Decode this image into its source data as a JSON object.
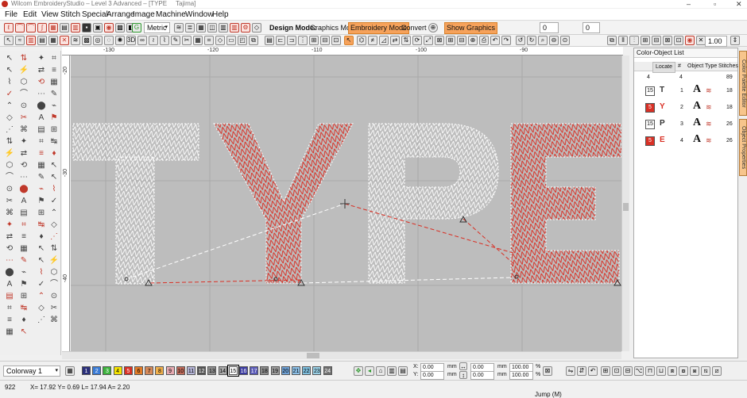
{
  "titlebar": {
    "title": "Wilcom EmbroideryStudio – Level 3 Advanced – [TYPE",
    "machine": "Tajima]"
  },
  "menu": [
    "File",
    "Edit",
    "View",
    "Stitch",
    "Special",
    "Arrange",
    "Image",
    "Machine",
    "Window",
    "Help"
  ],
  "toolbar1": {
    "units": "Metric",
    "design_mode_label": "Design Mode:",
    "graphics_mode": "Graphics Mode",
    "embroidery_mode": "Embroidery Mode",
    "convert": "Convert",
    "show_graphics": "Show Graphics"
  },
  "toolbar2": {
    "field_a": "0",
    "field_b": "0",
    "zoom": "1.00"
  },
  "rulers": {
    "top": [
      "-130",
      "-120",
      "-110",
      "-100",
      "-90"
    ],
    "left": [
      "-20",
      "-30",
      "-40"
    ]
  },
  "design": {
    "letters": [
      {
        "char": "T",
        "color": "white"
      },
      {
        "char": "Y",
        "color": "red"
      },
      {
        "char": "P",
        "color": "white"
      },
      {
        "char": "E",
        "color": "red"
      }
    ]
  },
  "panel": {
    "title": "Color-Object List",
    "locate": "Locate",
    "columns": [
      "#",
      "Object Type",
      "Stitches"
    ],
    "header_row": {
      "a": "4",
      "b": "4",
      "c": "89"
    },
    "rows": [
      {
        "color_num": "15",
        "letter": "T",
        "index": "1",
        "stitches": "18",
        "swatch": "#ffffff",
        "letter_color": "#333333"
      },
      {
        "color_num": "5",
        "letter": "Y",
        "index": "2",
        "stitches": "18",
        "swatch": "#d93025",
        "letter_color": "#d93025"
      },
      {
        "color_num": "15",
        "letter": "P",
        "index": "3",
        "stitches": "26",
        "swatch": "#ffffff",
        "letter_color": "#333333"
      },
      {
        "color_num": "5",
        "letter": "E",
        "index": "4",
        "stitches": "26",
        "swatch": "#d93025",
        "letter_color": "#d93025"
      }
    ],
    "tabs": [
      "Color Palette Editor",
      "Object Properties"
    ]
  },
  "colorbar": {
    "colorway": "Colorway 1",
    "palette": [
      {
        "n": "1",
        "c": "#2a2f7a"
      },
      {
        "n": "2",
        "c": "#3a7bd5"
      },
      {
        "n": "3",
        "c": "#3db23d"
      },
      {
        "n": "4",
        "c": "#f5e300"
      },
      {
        "n": "5",
        "c": "#d93025"
      },
      {
        "n": "6",
        "c": "#e27b27"
      },
      {
        "n": "7",
        "c": "#d68a5a"
      },
      {
        "n": "8",
        "c": "#f1b04c"
      },
      {
        "n": "9",
        "c": "#e7aab1"
      },
      {
        "n": "10",
        "c": "#c16b5a"
      },
      {
        "n": "11",
        "c": "#b6b6d8"
      },
      {
        "n": "12",
        "c": "#545454"
      },
      {
        "n": "13",
        "c": "#8f8f8f"
      },
      {
        "n": "14",
        "c": "#a8a8a8"
      },
      {
        "n": "15",
        "c": "#ffffff"
      },
      {
        "n": "16",
        "c": "#3a3aa0"
      },
      {
        "n": "17",
        "c": "#5a5ab8"
      },
      {
        "n": "18",
        "c": "#8c8c8c"
      },
      {
        "n": "19",
        "c": "#9c9c9c"
      },
      {
        "n": "20",
        "c": "#6ea1d6"
      },
      {
        "n": "21",
        "c": "#8cc0e8"
      },
      {
        "n": "22",
        "c": "#7fc0e0"
      },
      {
        "n": "23",
        "c": "#9ad0e6"
      },
      {
        "n": "24",
        "c": "#707070"
      }
    ],
    "x_label": "X:",
    "y_label": "Y:",
    "x_val": "0.00",
    "y_val": "0.00",
    "w_val": "0.00",
    "h_val": "0.00",
    "unit": "mm",
    "pw": "100.00",
    "ph": "100.00",
    "pct": "%"
  },
  "status": {
    "count": "922",
    "coords": "X= 17.92 Y= 0.69 L= 17.94 A= 2.20",
    "mode": "Jump (M)"
  }
}
